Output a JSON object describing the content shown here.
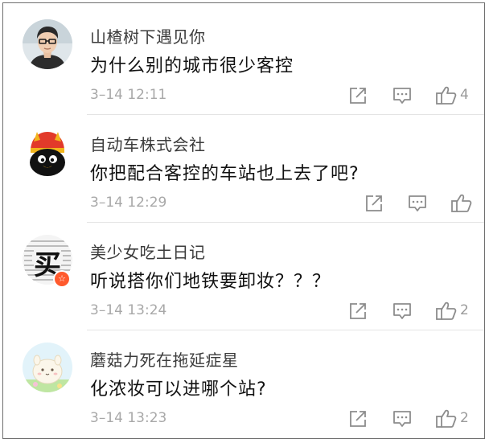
{
  "comments": [
    {
      "username": "山楂树下遇见你",
      "content": "为什么别的城市很少客控",
      "time": "3–14 12:11",
      "likes": "4",
      "avatar": "man-glasses-avatar"
    },
    {
      "username": "自动车株式会社",
      "content": "你把配合客控的车站也上去了吧?",
      "time": "3–14 12:29",
      "likes": "",
      "avatar": "penguin-hat-avatar"
    },
    {
      "username": "美少女吃土日记",
      "content": "听说搭你们地铁要卸妆？？？",
      "time": "3–14 13:24",
      "likes": "2",
      "avatar": "text-collage-avatar",
      "avatar_text": "买",
      "verified": "☆"
    },
    {
      "username": "蘑菇力死在拖延症星",
      "content": "化浓妆可以进哪个站?",
      "time": "3–14 13:23",
      "likes": "2",
      "avatar": "cartoon-sheep-avatar"
    }
  ],
  "icons": {
    "share": "share-icon",
    "reply": "comment-icon",
    "like": "thumbs-up-icon"
  },
  "colors": {
    "username": "#3b3b3b",
    "content": "#111111",
    "meta": "#a8a8a8",
    "icon": "#8c8c8c",
    "divider": "#e4e4e4"
  }
}
